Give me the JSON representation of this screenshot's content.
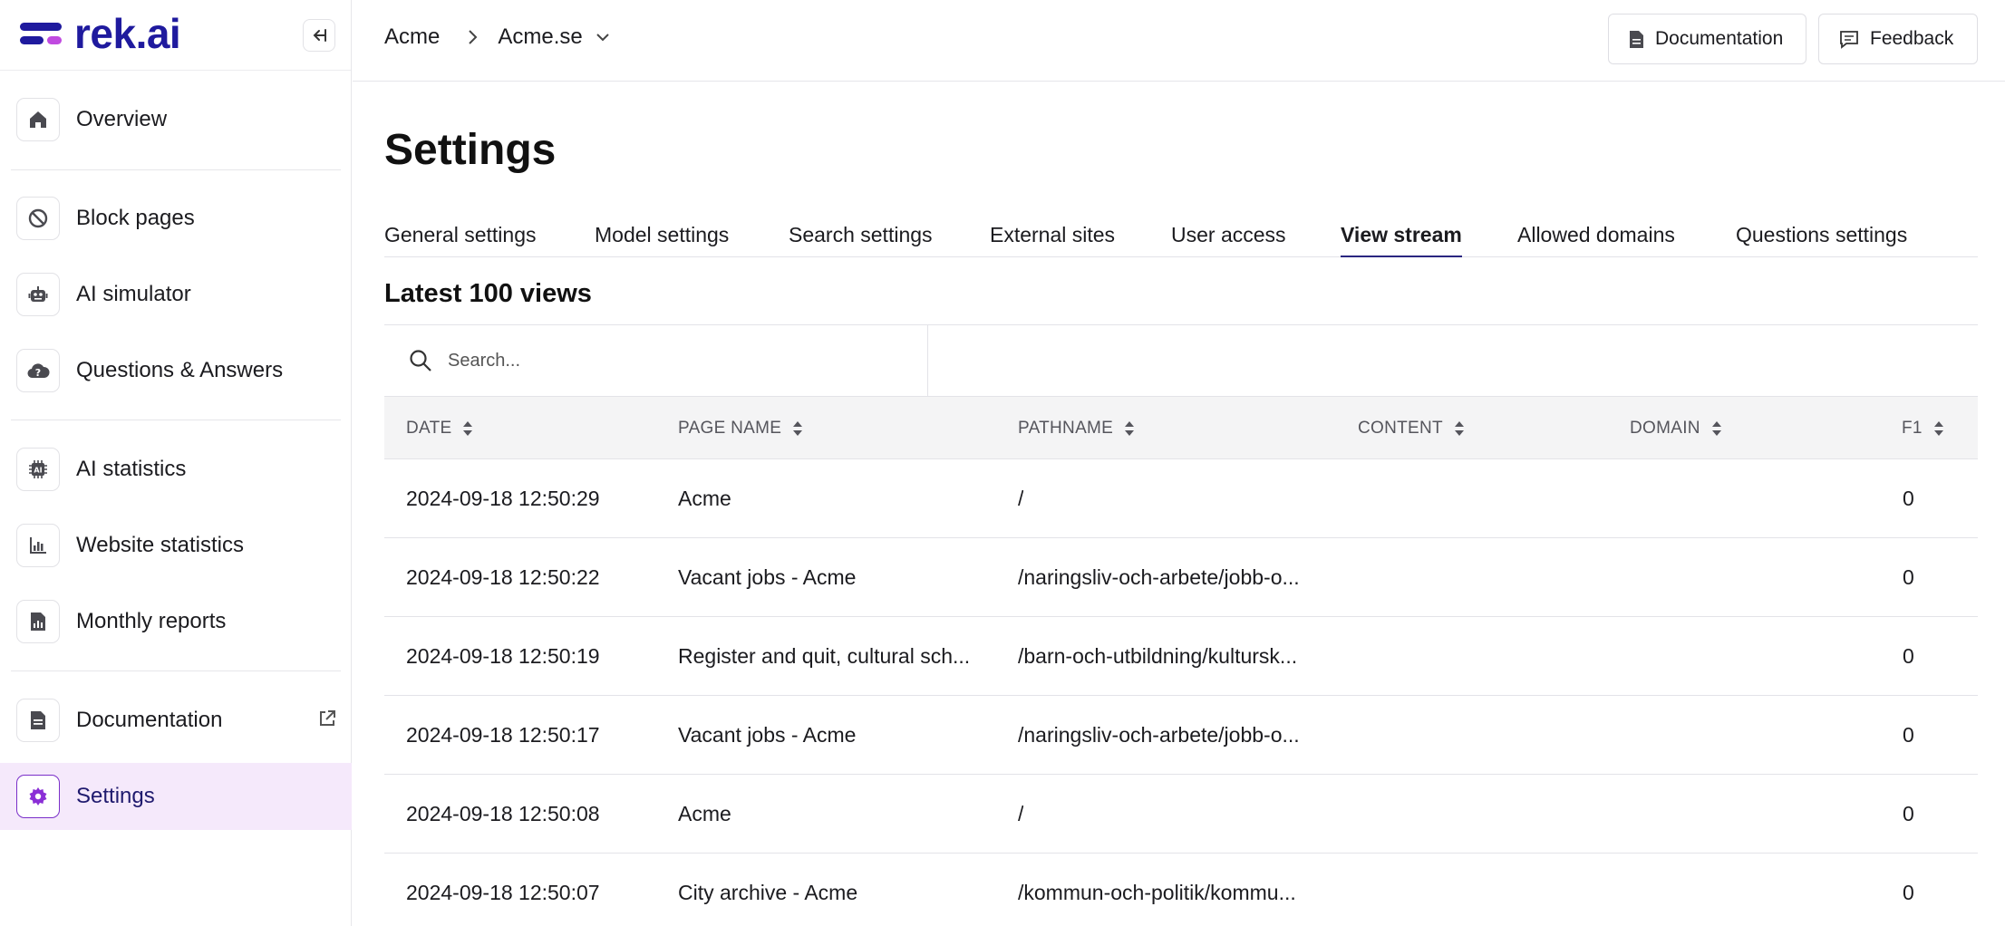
{
  "app": {
    "logo_text": "rek.ai",
    "brand_color": "#1f1a9e",
    "accent_color": "#c04ae0"
  },
  "sidebar": {
    "collapse_icon": "collapse-left-icon",
    "items": [
      {
        "label": "Overview",
        "icon": "home-icon"
      },
      {
        "label": "Block pages",
        "icon": "block-icon"
      },
      {
        "label": "AI simulator",
        "icon": "robot-icon"
      },
      {
        "label": "Questions & Answers",
        "icon": "cloud-question-icon"
      },
      {
        "label": "AI statistics",
        "icon": "ai-chip-icon"
      },
      {
        "label": "Website statistics",
        "icon": "bar-chart-icon"
      },
      {
        "label": "Monthly reports",
        "icon": "report-icon"
      },
      {
        "label": "Documentation",
        "icon": "document-icon"
      },
      {
        "label": "Settings",
        "icon": "gear-icon"
      }
    ]
  },
  "header": {
    "breadcrumb": [
      "Acme",
      "Acme.se"
    ],
    "documentation_label": "Documentation",
    "feedback_label": "Feedback"
  },
  "main": {
    "title": "Settings",
    "tabs": [
      {
        "label": "General settings"
      },
      {
        "label": "Model settings"
      },
      {
        "label": "Search settings"
      },
      {
        "label": "External sites"
      },
      {
        "label": "User access"
      },
      {
        "label": "View stream",
        "active": true
      },
      {
        "label": "Allowed domains"
      },
      {
        "label": "Questions settings"
      }
    ],
    "section_title": "Latest 100 views",
    "search_placeholder": "Search...",
    "table": {
      "columns": [
        "DATE",
        "PAGE NAME",
        "PATHNAME",
        "CONTENT",
        "DOMAIN",
        "F1"
      ],
      "rows": [
        [
          "2024-09-18 12:50:29",
          "Acme",
          "/",
          "",
          "",
          "0"
        ],
        [
          "2024-09-18 12:50:22",
          "Vacant jobs - Acme",
          "/naringsliv-och-arbete/jobb-o...",
          "",
          "",
          "0"
        ],
        [
          "2024-09-18 12:50:19",
          "Register and quit, cultural sch...",
          "/barn-och-utbildning/kultursk...",
          "",
          "",
          "0"
        ],
        [
          "2024-09-18 12:50:17",
          "Vacant jobs - Acme",
          "/naringsliv-och-arbete/jobb-o...",
          "",
          "",
          "0"
        ],
        [
          "2024-09-18 12:50:08",
          "Acme",
          "/",
          "",
          "",
          "0"
        ],
        [
          "2024-09-18 12:50:07",
          "City archive - Acme",
          "/kommun-och-politik/kommu...",
          "",
          "",
          "0"
        ]
      ]
    }
  }
}
